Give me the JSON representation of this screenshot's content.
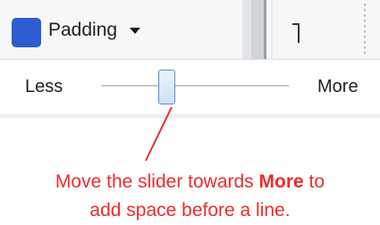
{
  "toolbar": {
    "swatch_color": "#2c5ccf",
    "dropdown_label": "Padding",
    "dropdown_icon": "caret-down-icon"
  },
  "slider": {
    "min_label": "Less",
    "max_label": "More",
    "value_fraction": 0.35
  },
  "annotation": {
    "line1_before": "Move the slider towards ",
    "line1_emphasis": "More",
    "line1_after": " to",
    "line2": "add space before a line.",
    "color": "#ee2b2b"
  }
}
